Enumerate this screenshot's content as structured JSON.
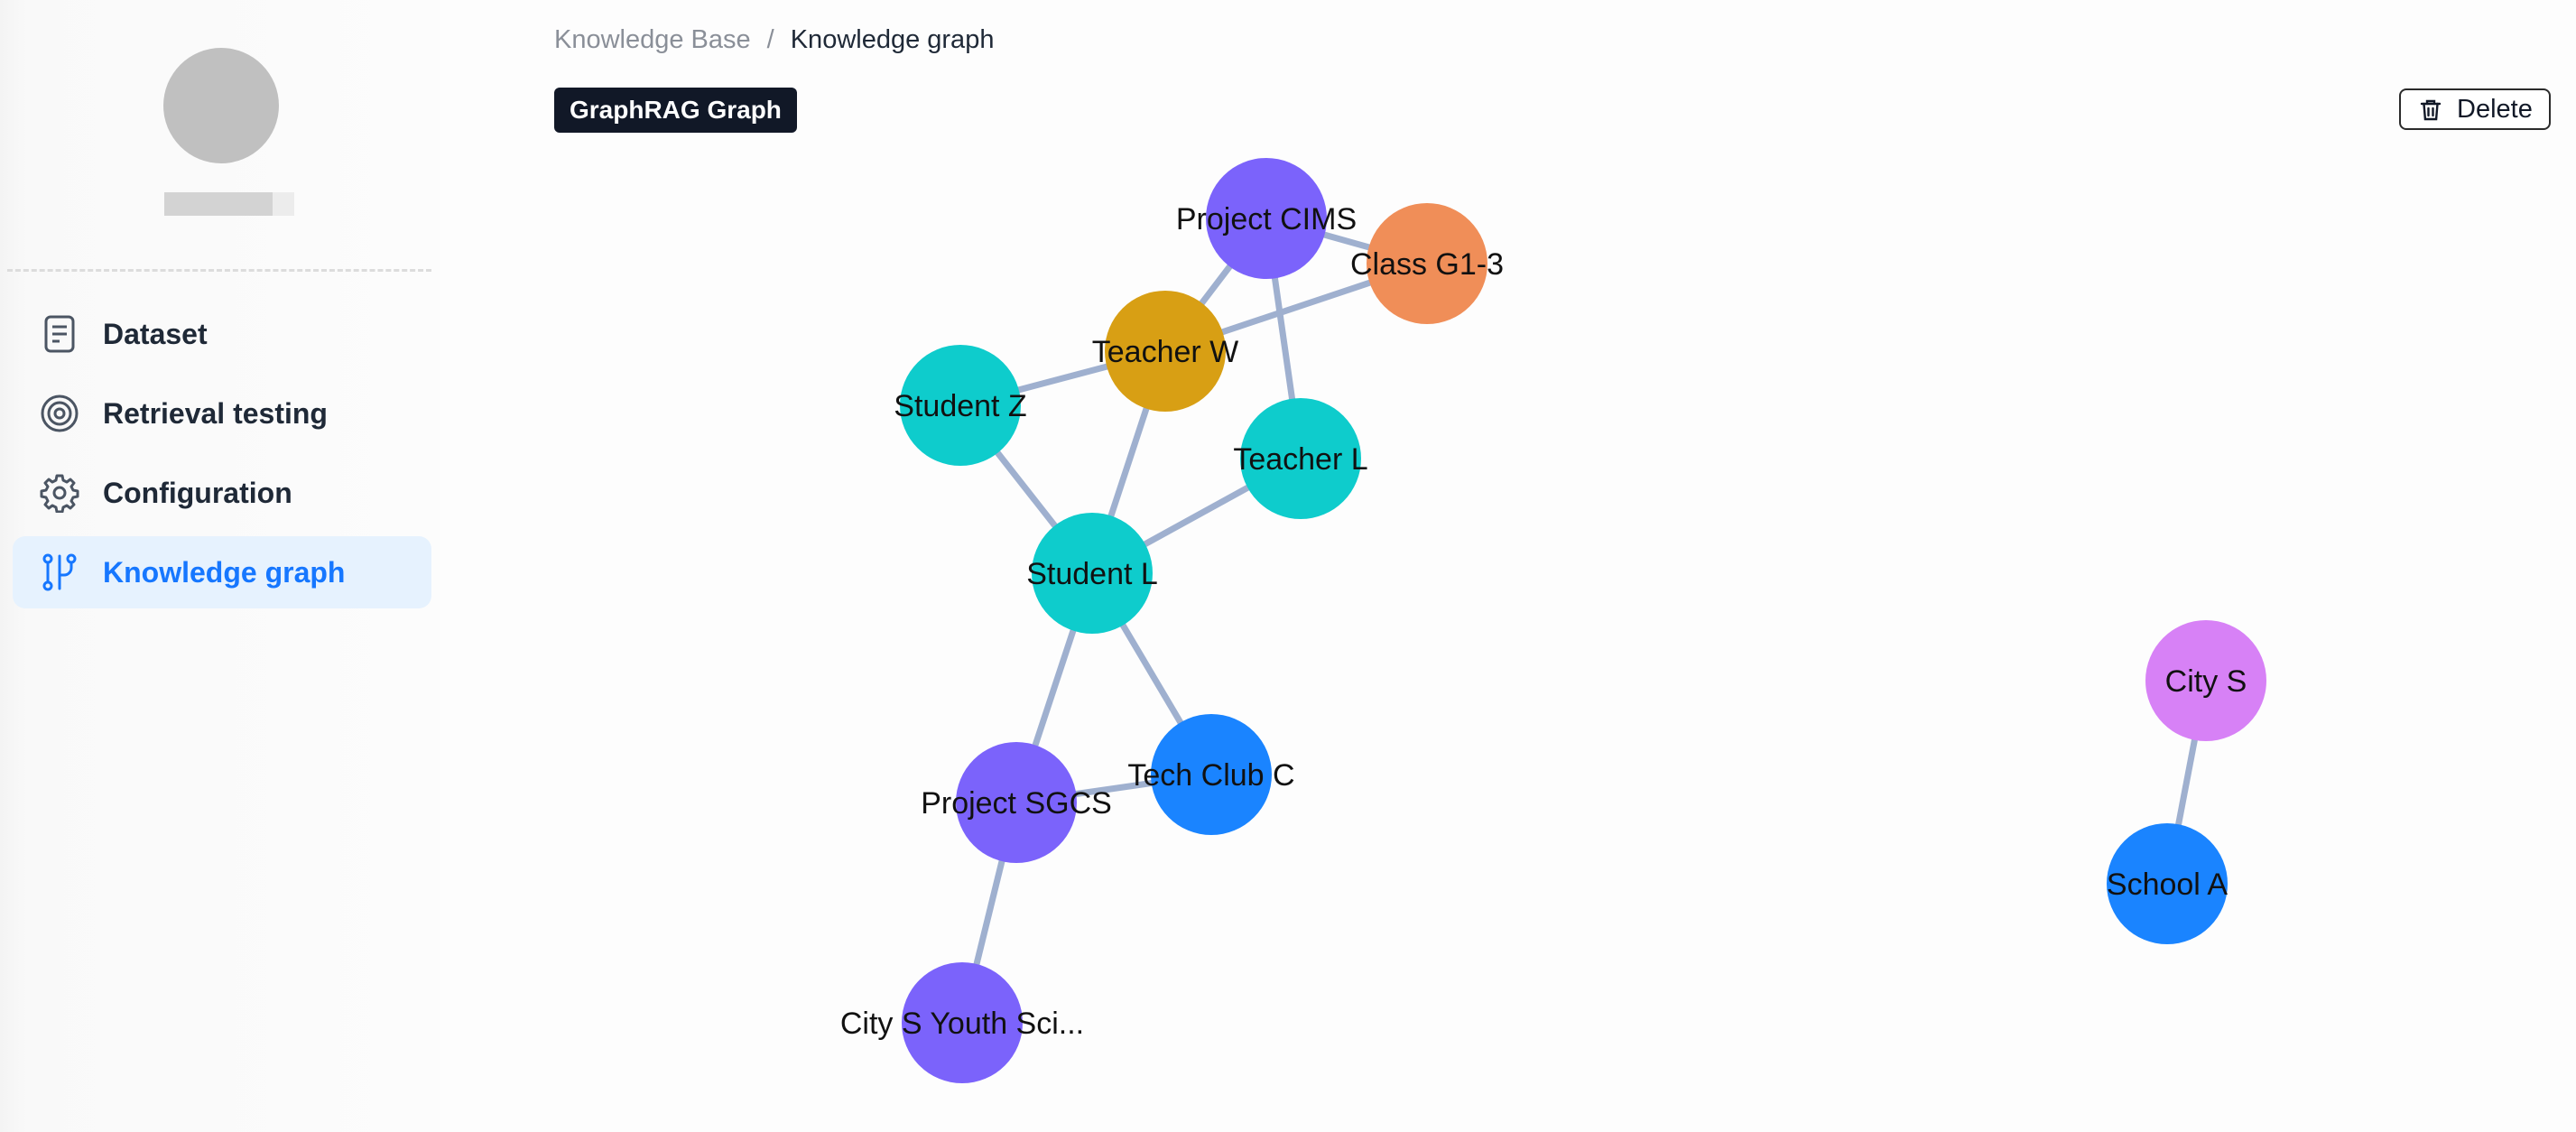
{
  "sidebar": {
    "items": [
      {
        "label": "Dataset",
        "icon": "document-icon",
        "active": false
      },
      {
        "label": "Retrieval testing",
        "icon": "target-icon",
        "active": false
      },
      {
        "label": "Configuration",
        "icon": "gear-icon",
        "active": false
      },
      {
        "label": "Knowledge graph",
        "icon": "graph-branch-icon",
        "active": true
      }
    ]
  },
  "breadcrumb": {
    "parent": "Knowledge Base",
    "separator": "/",
    "current": "Knowledge graph"
  },
  "header": {
    "badge": "GraphRAG Graph",
    "delete_label": "Delete"
  },
  "colors": {
    "accent": "#1677ff",
    "active_bg": "#e6f2fe",
    "edge": "#9fb0cf",
    "node_purple": "#7b63fb",
    "node_orange": "#f08e58",
    "node_gold": "#d89f14",
    "node_teal": "#0ecccc",
    "node_blue": "#1a84ff",
    "node_pink": "#d781f6"
  },
  "graph": {
    "nodes": [
      {
        "id": "project-cims",
        "label": "Project CIMS",
        "color": "#7b63fb"
      },
      {
        "id": "class-g1-3",
        "label": "Class G1-3",
        "color": "#f08e58"
      },
      {
        "id": "teacher-w",
        "label": "Teacher W",
        "color": "#d89f14"
      },
      {
        "id": "student-z",
        "label": "Student Z",
        "color": "#0ecccc"
      },
      {
        "id": "teacher-l",
        "label": "Teacher L",
        "color": "#0ecccc"
      },
      {
        "id": "student-l",
        "label": "Student L",
        "color": "#0ecccc"
      },
      {
        "id": "tech-club-c",
        "label": "Tech Club C",
        "color": "#1a84ff"
      },
      {
        "id": "project-sgcs",
        "label": "Project SGCS",
        "color": "#7b63fb"
      },
      {
        "id": "city-s-youth",
        "label": "City S Youth Sci...",
        "color": "#7b63fb"
      },
      {
        "id": "city-s",
        "label": "City S",
        "color": "#d781f6"
      },
      {
        "id": "school-a",
        "label": "School A",
        "color": "#1a84ff"
      }
    ],
    "edges": [
      [
        "project-cims",
        "class-g1-3"
      ],
      [
        "project-cims",
        "teacher-w"
      ],
      [
        "project-cims",
        "teacher-l"
      ],
      [
        "teacher-w",
        "class-g1-3"
      ],
      [
        "teacher-w",
        "student-z"
      ],
      [
        "teacher-w",
        "student-l"
      ],
      [
        "student-z",
        "student-l"
      ],
      [
        "teacher-l",
        "student-l"
      ],
      [
        "student-l",
        "project-sgcs"
      ],
      [
        "student-l",
        "tech-club-c"
      ],
      [
        "project-sgcs",
        "tech-club-c"
      ],
      [
        "project-sgcs",
        "city-s-youth"
      ],
      [
        "city-s",
        "school-a"
      ]
    ]
  }
}
